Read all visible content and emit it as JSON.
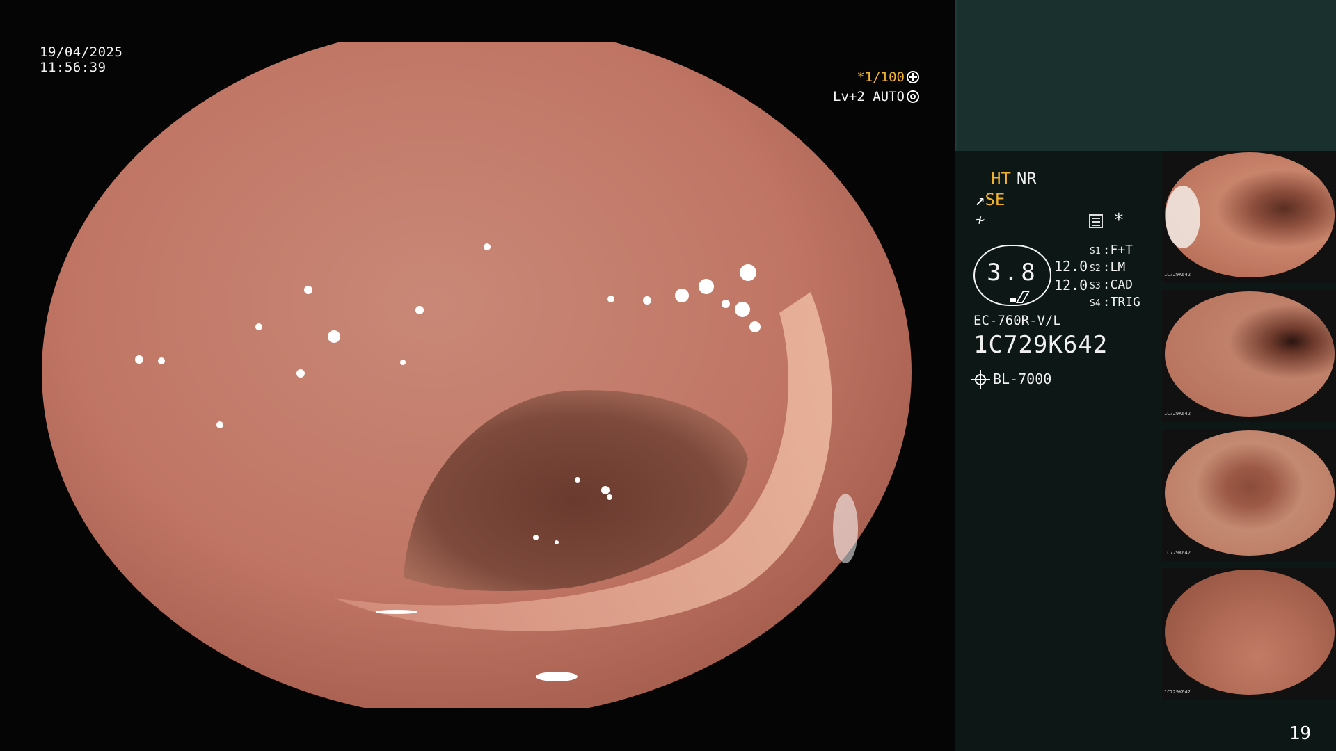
{
  "osd": {
    "date": "19/04/2025",
    "time": "11:56:39",
    "shutter": "*1/100",
    "iris": "Lv+2 AUTO"
  },
  "panel": {
    "ht_label": "HT",
    "nr_label": "NR",
    "se_symbol": "↗",
    "se_label": "SE",
    "f_symbol": "≁",
    "star": "*",
    "gauge_value": "3.8",
    "gauge_side_1": "12.0",
    "gauge_side_2": "12.0",
    "s_modes": [
      {
        "key": "S1",
        "value": "F+T"
      },
      {
        "key": "S2",
        "value": "LM"
      },
      {
        "key": "S3",
        "value": "CAD"
      },
      {
        "key": "S4",
        "value": "TRIG"
      }
    ],
    "scope_model": "EC-760R-V/L",
    "scope_serial": "1C729K642",
    "light_source": "BL-7000",
    "page_number": "19"
  },
  "thumbnails": [
    {
      "serial": "1C729K642"
    },
    {
      "serial": "1C729K642"
    },
    {
      "serial": "1C729K642"
    },
    {
      "serial": "1C729K642"
    }
  ],
  "colors": {
    "panel_bg": "#0c1716",
    "panel_top_bg": "#1a302f",
    "accent_yellow": "#f2b22c",
    "mucosa": "#c98170"
  },
  "icons": [
    "shutter-icon",
    "iris-icon",
    "menu-icon",
    "sun-icon"
  ]
}
